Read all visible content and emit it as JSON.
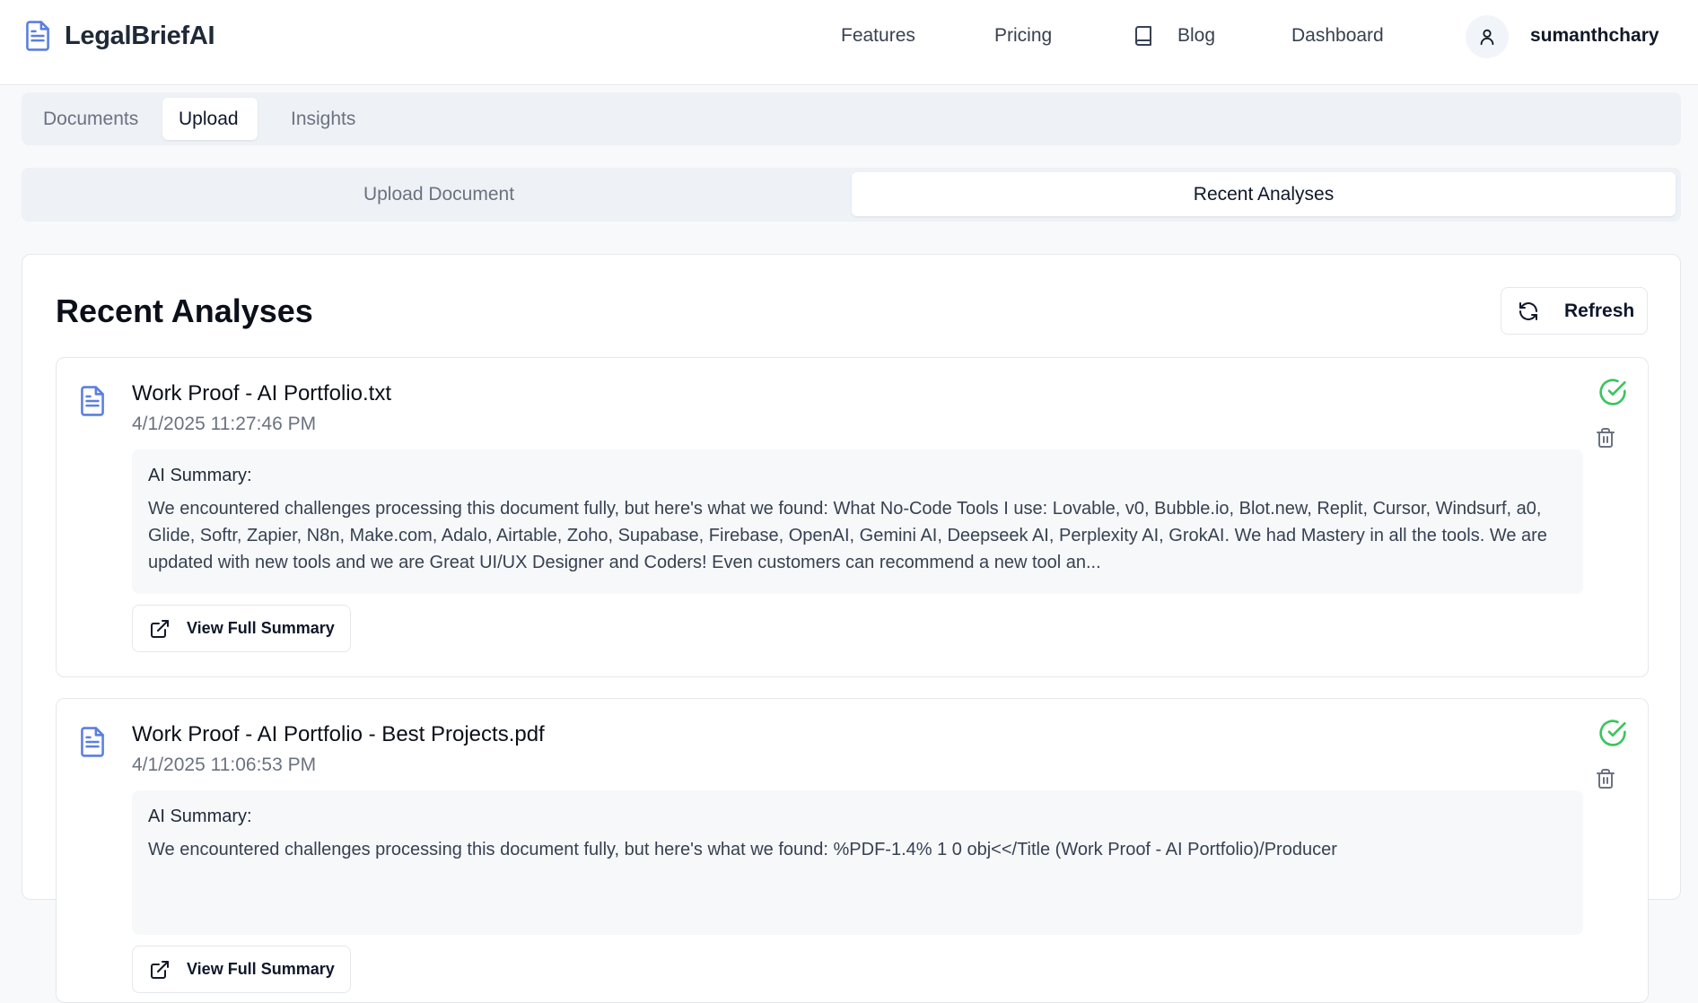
{
  "header": {
    "brand": "LegalBriefAI",
    "nav": {
      "features": "Features",
      "pricing": "Pricing",
      "blog": "Blog",
      "dashboard": "Dashboard"
    },
    "username": "sumanthchary"
  },
  "tabs": {
    "documents": "Documents",
    "upload": "Upload",
    "insights": "Insights",
    "active": "Upload"
  },
  "subtabs": {
    "upload_document": "Upload Document",
    "recent_analyses": "Recent Analyses",
    "active": "Recent Analyses"
  },
  "main": {
    "title": "Recent Analyses",
    "refresh_label": "Refresh",
    "items": [
      {
        "title": "Work Proof - AI Portfolio.txt",
        "date": "4/1/2025 11:27:46 PM",
        "summary_label": "AI Summary:",
        "summary": "We encountered challenges processing this document fully, but here's what we found: What No-Code Tools I use: Lovable, v0, Bubble.io, Blot.new, Replit, Cursor, Windsurf, a0, Glide, Softr, Zapier, N8n, Make.com, Adalo, Airtable, Zoho, Supabase, Firebase, OpenAI, Gemini AI, Deepseek AI, Perplexity AI, GrokAI. We had Mastery in all the tools. We are updated with new tools and we are Great UI/UX Designer and Coders! Even customers can recommend a new tool an...",
        "view_label": "View Full Summary",
        "status": "completed"
      },
      {
        "title": "Work Proof - AI Portfolio - Best Projects.pdf",
        "date": "4/1/2025 11:06:53 PM",
        "summary_label": "AI Summary:",
        "summary": "We encountered challenges processing this document fully, but here's what we found: %PDF-1.4% 1 0 obj<</Title (Work Proof - AI Portfolio)/Producer",
        "view_label": "View Full Summary",
        "status": "completed"
      }
    ]
  },
  "icons": {
    "brand": "document-icon",
    "blog": "book-icon",
    "avatar": "user-icon",
    "refresh": "refresh-icon",
    "file": "file-text-icon",
    "status": "check-circle-icon",
    "delete": "trash-icon",
    "external": "external-link-icon"
  },
  "colors": {
    "accent_blue": "#5b7fe0",
    "success_green": "#3cc45f",
    "text_muted": "#6b7280"
  }
}
